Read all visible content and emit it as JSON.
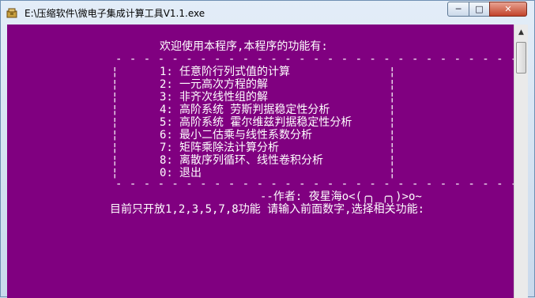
{
  "window": {
    "title": "E:\\压缩软件\\微电子集成计算工具V1.1.exe",
    "controls": {
      "minimize": "─",
      "maximize": "□",
      "close": "✕"
    }
  },
  "console": {
    "background": "#800080",
    "text_color": "#ffffff",
    "header": "欢迎使用本程序,本程序的功能有:",
    "separator": "- - - - - - - - - - - - - - - - - - - - - - - - - - - - - - - - - - - - -",
    "border_char": "¦",
    "menu": [
      {
        "num": "1:",
        "label": "任意阶行列式值的计算"
      },
      {
        "num": "2:",
        "label": "一元高次方程的解"
      },
      {
        "num": "3:",
        "label": "非齐次线性组的解"
      },
      {
        "num": "4:",
        "label": "高阶系统 劳斯判据稳定性分析"
      },
      {
        "num": "5:",
        "label": "高阶系统 霍尔维兹判据稳定性分析"
      },
      {
        "num": "6:",
        "label": "最小二估乘与线性系数分析"
      },
      {
        "num": "7:",
        "label": "矩阵乘除法计算分析"
      },
      {
        "num": "8:",
        "label": "离散序列循环、线性卷积分析"
      },
      {
        "num": "0:",
        "label": "退出"
      }
    ],
    "author": "--作者: 夜星海o<(╭╮_╭╮)>o~",
    "prompt": "目前只开放1,2,3,5,7,8功能 请输入前面数字,选择相关功能:"
  }
}
